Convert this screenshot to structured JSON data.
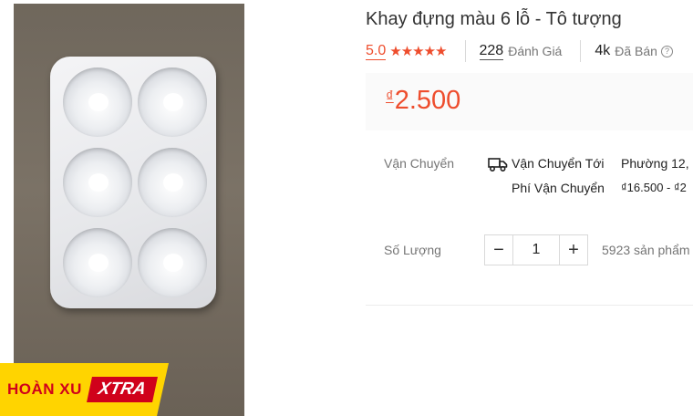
{
  "product": {
    "title": "Khay đựng màu 6 lỗ - Tô tượng",
    "badge": {
      "left": "HOÀN XU",
      "right": "XTRA"
    }
  },
  "rating": {
    "score": "5.0",
    "stars": "★★★★★",
    "reviews_count": "228",
    "reviews_label": "Đánh Giá",
    "sold_count": "4k",
    "sold_label": "Đã Bán",
    "help_glyph": "?"
  },
  "price": {
    "currency": "₫",
    "amount": "2.500"
  },
  "shipping": {
    "label": "Vận Chuyển",
    "to_label": "Vận Chuyển Tới",
    "to_value": "Phường 12,",
    "fee_label": "Phí Vận Chuyển",
    "fee_value": "₫16.500 - ₫2"
  },
  "quantity": {
    "label": "Số Lượng",
    "value": "1",
    "minus": "−",
    "plus": "+",
    "stock": "5923 sản phẩm"
  },
  "colors": {
    "accent": "#ee4d2d",
    "badge_yellow": "#ffd400",
    "badge_red": "#d0011b"
  },
  "icons": {
    "shipping": "truck-icon",
    "help": "help-icon"
  }
}
